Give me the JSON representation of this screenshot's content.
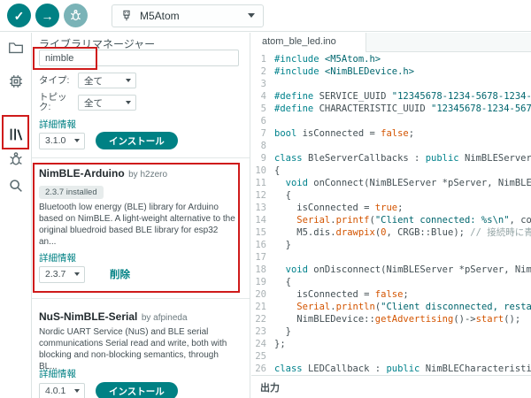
{
  "colors": {
    "accent": "#008184",
    "annotation": "#cf1b1b"
  },
  "toolbar": {
    "verify_icon": "✓",
    "upload_icon": "→",
    "board": "M5Atom"
  },
  "library_panel": {
    "title": "ライブラリマネージャー",
    "search_value": "nimble",
    "filters": {
      "type_label": "タイプ:",
      "type_value": "全て",
      "topic_label": "トピック:",
      "topic_value": "全て"
    },
    "cards": [
      {
        "more_info": "詳細情報",
        "version": "3.1.0",
        "action": "インストール"
      },
      {
        "name": "NimBLE-Arduino",
        "author": "by h2zero",
        "badge": "2.3.7 installed",
        "description": "Bluetooth low energy (BLE) library for Arduino based on NimBLE. A light-weight alternative to the original bluedroid based BLE library for esp32 an...",
        "more_info": "詳細情報",
        "version": "2.3.7",
        "action": "削除"
      },
      {
        "name": "NuS-NimBLE-Serial",
        "author": "by afpineda",
        "description": "Nordic UART Service (NuS) and BLE serial communications Serial read and write, both with blocking and non-blocking semantics, through BL...",
        "more_info": "詳細情報",
        "version": "4.0.1",
        "action": "インストール"
      }
    ]
  },
  "editor": {
    "tab": "atom_ble_led.ino",
    "output_label": "出力",
    "code": {
      "lines": [
        {
          "n": 1,
          "t": [
            [
              "kw",
              "#include "
            ],
            [
              "str",
              "<M5Atom.h>"
            ]
          ]
        },
        {
          "n": 2,
          "t": [
            [
              "kw",
              "#include "
            ],
            [
              "str",
              "<NimBLEDevice.h>"
            ]
          ]
        },
        {
          "n": 3,
          "t": []
        },
        {
          "n": 4,
          "t": [
            [
              "kw",
              "#define "
            ],
            [
              "pl",
              "SERVICE_UUID "
            ],
            [
              "str",
              "\"12345678-1234-5678-1234-5"
            ]
          ]
        },
        {
          "n": 5,
          "t": [
            [
              "kw",
              "#define "
            ],
            [
              "pl",
              "CHARACTERISTIC_UUID "
            ],
            [
              "str",
              "\"12345678-1234-5678"
            ]
          ]
        },
        {
          "n": 6,
          "t": []
        },
        {
          "n": 7,
          "t": [
            [
              "kw",
              "bool "
            ],
            [
              "pl",
              "isConnected = "
            ],
            [
              "lit",
              "false"
            ],
            [
              "pl",
              ";"
            ]
          ]
        },
        {
          "n": 8,
          "t": []
        },
        {
          "n": 9,
          "t": [
            [
              "kw",
              "class "
            ],
            [
              "pl",
              "BleServerCallbacks : "
            ],
            [
              "kw",
              "public"
            ],
            [
              "pl",
              " NimBLEServerC"
            ]
          ]
        },
        {
          "n": 10,
          "t": [
            [
              "pl",
              "{"
            ]
          ]
        },
        {
          "n": 11,
          "t": [
            [
              "pl",
              "  "
            ],
            [
              "kw",
              "void"
            ],
            [
              "pl",
              " onConnect(NimBLEServer *pServer, NimBLEC"
            ]
          ]
        },
        {
          "n": 12,
          "t": [
            [
              "pl",
              "  {"
            ]
          ]
        },
        {
          "n": 13,
          "t": [
            [
              "pl",
              "    isConnected = "
            ],
            [
              "lit",
              "true"
            ],
            [
              "pl",
              ";"
            ]
          ]
        },
        {
          "n": 14,
          "t": [
            [
              "pl",
              "    "
            ],
            [
              "fn",
              "Serial"
            ],
            [
              "pl",
              "."
            ],
            [
              "fn",
              "printf"
            ],
            [
              "pl",
              "("
            ],
            [
              "str",
              "\"Client connected: %s\\n\""
            ],
            [
              "pl",
              ", con"
            ]
          ]
        },
        {
          "n": 15,
          "t": [
            [
              "pl",
              "    M5.dis."
            ],
            [
              "fn",
              "drawpix"
            ],
            [
              "pl",
              "("
            ],
            [
              "lit",
              "0"
            ],
            [
              "pl",
              ", CRGB::Blue); "
            ],
            [
              "cm",
              "// 接続時に青"
            ]
          ]
        },
        {
          "n": 16,
          "t": [
            [
              "pl",
              "  }"
            ]
          ]
        },
        {
          "n": 17,
          "t": []
        },
        {
          "n": 18,
          "t": [
            [
              "pl",
              "  "
            ],
            [
              "kw",
              "void"
            ],
            [
              "pl",
              " onDisconnect(NimBLEServer *pServer, NimB"
            ]
          ]
        },
        {
          "n": 19,
          "t": [
            [
              "pl",
              "  {"
            ]
          ]
        },
        {
          "n": 20,
          "t": [
            [
              "pl",
              "    isConnected = "
            ],
            [
              "lit",
              "false"
            ],
            [
              "pl",
              ";"
            ]
          ]
        },
        {
          "n": 21,
          "t": [
            [
              "pl",
              "    "
            ],
            [
              "fn",
              "Serial"
            ],
            [
              "pl",
              "."
            ],
            [
              "fn",
              "println"
            ],
            [
              "pl",
              "("
            ],
            [
              "str",
              "\"Client disconnected, restar"
            ]
          ]
        },
        {
          "n": 22,
          "t": [
            [
              "pl",
              "    NimBLEDevice::"
            ],
            [
              "fn",
              "getAdvertising"
            ],
            [
              "pl",
              "()->"
            ],
            [
              "fn",
              "start"
            ],
            [
              "pl",
              "();"
            ]
          ]
        },
        {
          "n": 23,
          "t": [
            [
              "pl",
              "  }"
            ]
          ]
        },
        {
          "n": 24,
          "t": [
            [
              "pl",
              "};"
            ]
          ]
        },
        {
          "n": 25,
          "t": []
        },
        {
          "n": 26,
          "t": [
            [
              "kw",
              "class "
            ],
            [
              "pl",
              "LEDCallback : "
            ],
            [
              "kw",
              "public"
            ],
            [
              "pl",
              " NimBLECharacteristic"
            ]
          ]
        }
      ]
    }
  }
}
